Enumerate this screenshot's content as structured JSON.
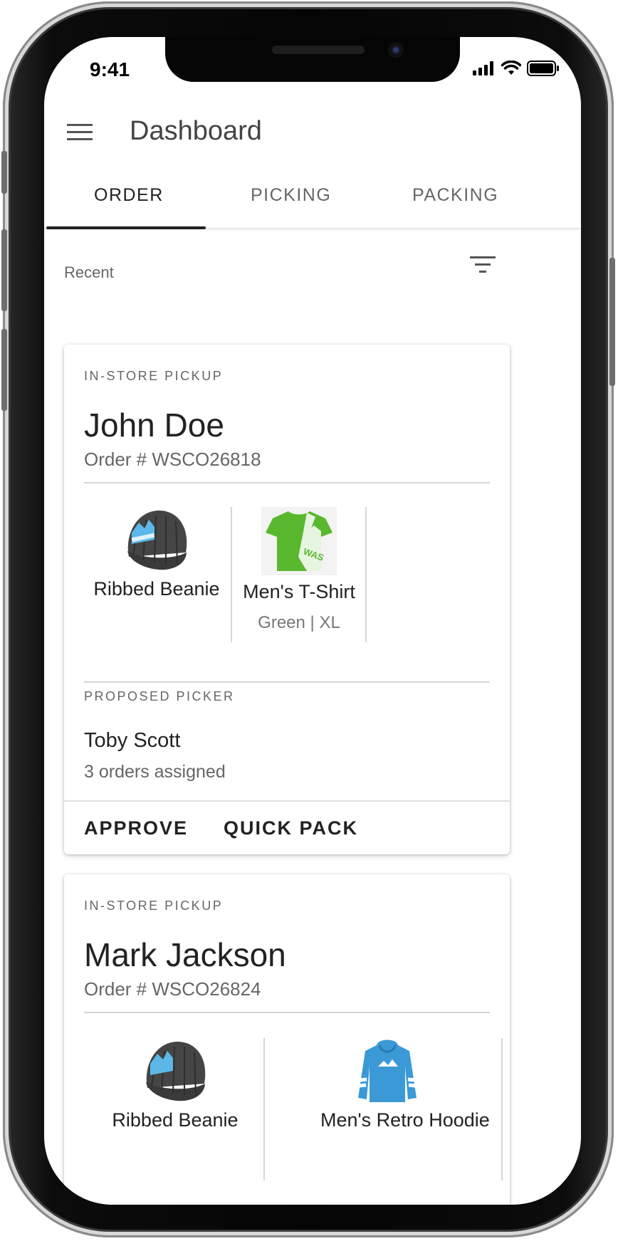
{
  "status_bar": {
    "time": "9:41"
  },
  "app_bar": {
    "title": "Dashboard"
  },
  "tabs": [
    {
      "label": "ORDER",
      "active": true
    },
    {
      "label": "PICKING",
      "active": false
    },
    {
      "label": "PACKING",
      "active": false
    }
  ],
  "section": {
    "label": "Recent"
  },
  "orders": [
    {
      "type": "IN-STORE PICKUP",
      "customer": "John Doe",
      "order_number": "Order # WSCO26818",
      "items": [
        {
          "name": "Ribbed Beanie",
          "variant": "",
          "image": "beanie-image"
        },
        {
          "name": "Men's T-Shirt",
          "variant": "Green | XL",
          "image": "tshirt-image"
        }
      ],
      "picker_label": "PROPOSED PICKER",
      "picker_name": "Toby Scott",
      "picker_sub": "3 orders assigned",
      "actions": [
        "APPROVE",
        "QUICK PACK"
      ]
    },
    {
      "type": "IN-STORE PICKUP",
      "customer": "Mark Jackson",
      "order_number": "Order # WSCO26824",
      "items": [
        {
          "name": "Ribbed Beanie",
          "image": "beanie-image"
        },
        {
          "name": "Men's Retro Hoodie",
          "image": "hoodie-image"
        }
      ]
    }
  ],
  "colors": {
    "text_primary": "#222222",
    "text_secondary": "#666666",
    "beanie": "#4a4a4a",
    "tshirt": "#5ab82e",
    "hoodie": "#3b9ad6"
  }
}
